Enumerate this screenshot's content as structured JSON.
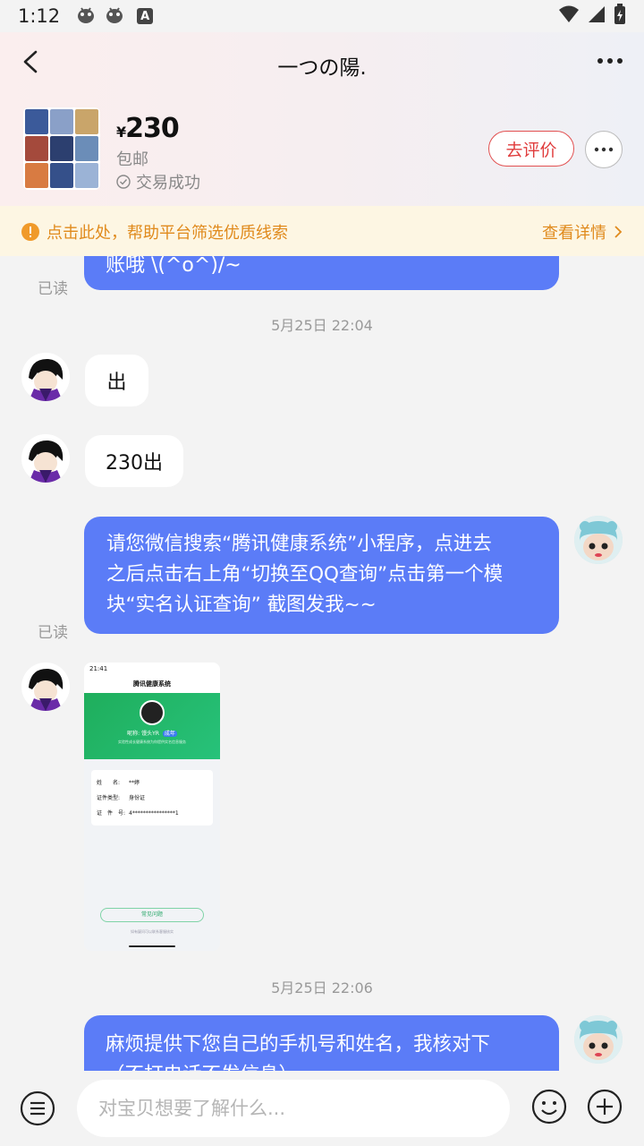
{
  "status_bar": {
    "time": "1:12",
    "letter_icon": "A"
  },
  "nav": {
    "title": "一つの陽."
  },
  "goods": {
    "currency": "¥",
    "price": "230",
    "shipping": "包邮",
    "status": "交易成功",
    "rate_label": "去评价"
  },
  "notice": {
    "text": "点击此处，帮助平台筛选优质线索",
    "link": "查看详情"
  },
  "chat": {
    "partial_top_msg": "账哦 \\(^o^)/~",
    "read_1": "已读",
    "time_1": "5月25日 22:04",
    "msg_in_1": "出",
    "msg_in_2": "230出",
    "msg_out_2_lines": [
      "请您微信搜索“腾讯健康系统”小程序，点进去",
      "之后点击右上角“切换至QQ查询”点击第一个模",
      "块“实名认证查询” 截图发我~~"
    ],
    "read_2": "已读",
    "screenshot": {
      "time": "21:41",
      "title": "腾讯健康系统",
      "nickname": "昵称: 馒头YR",
      "tag": "成年",
      "sub": "实验性成长健康系统为你提供实名信息服务",
      "rows": [
        {
          "k": "姓　　名:",
          "v": "**婷"
        },
        {
          "k": "证件类型:",
          "v": "身份证"
        },
        {
          "k": "证　件　号:",
          "v": "4****************1"
        }
      ],
      "faq": "常见问题",
      "footer": "如有疑问可以联系客服核实"
    },
    "time_2": "5月25日 22:06",
    "msg_out_3_lines": [
      "麻烦提供下您自己的手机号和姓名，我核对下",
      "（不打电话不发信息）"
    ]
  },
  "bottom": {
    "placeholder": "对宝贝想要了解什么..."
  },
  "icons": {
    "back": "chevron-left-icon",
    "more": "more-icon",
    "check": "check-circle-icon",
    "warn": "warning-icon",
    "menu": "menu-icon",
    "emoji": "emoji-icon",
    "plus": "plus-icon"
  },
  "colors": {
    "bubble_out": "#5b7cf7",
    "rate_border": "#e25050",
    "notice_bg": "#fdf6e3",
    "notice_text": "#e08a1c"
  }
}
